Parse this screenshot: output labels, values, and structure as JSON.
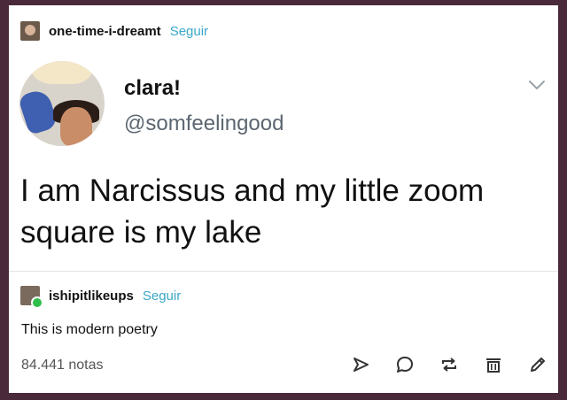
{
  "post": {
    "username": "one-time-i-dreamt",
    "follow_label": "Seguir"
  },
  "tweet": {
    "display_name": "clara!",
    "handle": "@somfeelingood",
    "text": "I am Narcissus and my little zoom square is my lake"
  },
  "reblog": {
    "username": "ishipitlikeups",
    "follow_label": "Seguir",
    "text": "This is modern poetry"
  },
  "footer": {
    "notes": "84.441 notas",
    "actions": [
      "share-icon",
      "reply-icon",
      "reblog-icon",
      "queue-icon",
      "edit-icon"
    ]
  },
  "colors": {
    "accent": "#3aa7c9",
    "reblog_badge": "#2fbf4a",
    "background": "#4a2a3a"
  }
}
